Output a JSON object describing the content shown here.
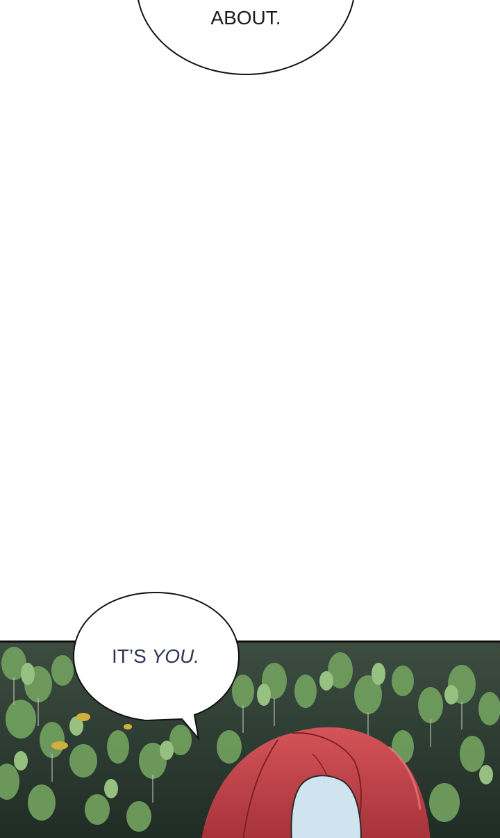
{
  "panels": {
    "top": {
      "bubble_text": "ABOUT."
    },
    "bottom": {
      "bubble_text_plain": "IT’S",
      "bubble_text_italic": "YOU."
    }
  },
  "colors": {
    "ink": "#111111",
    "speech_text": "#2e3556",
    "forest_dark": "#2b3a2e",
    "forest_light": "#8fc07a",
    "hair": "#c84a4d",
    "hair_shadow": "#a83238",
    "face": "#c9e0ea"
  }
}
